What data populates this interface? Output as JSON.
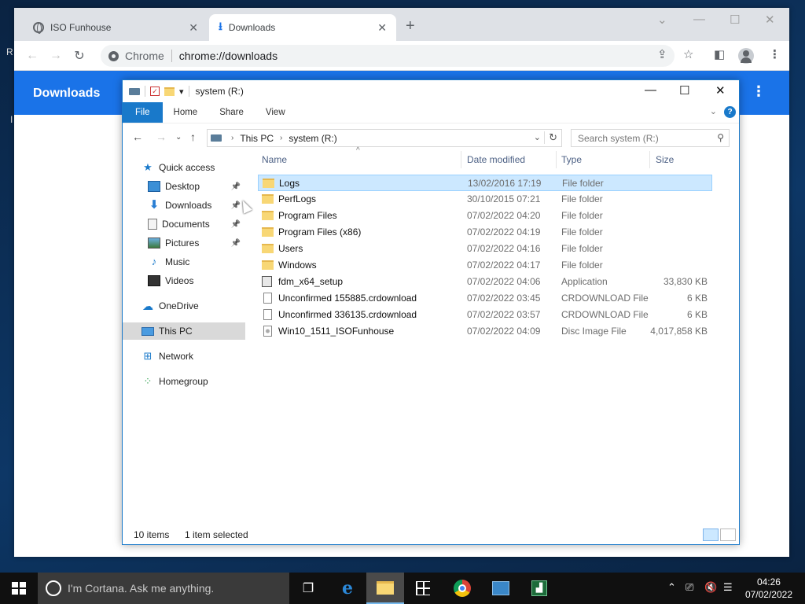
{
  "desktop": {
    "edge_letters": [
      "R",
      "I"
    ]
  },
  "chrome": {
    "tabs": [
      {
        "title": "ISO Funhouse",
        "active": false
      },
      {
        "title": "Downloads",
        "active": true
      }
    ],
    "omnibox": {
      "label": "Chrome",
      "url": "chrome://downloads"
    },
    "page": {
      "title": "Downloads"
    }
  },
  "explorer": {
    "title": "system (R:)",
    "ribbon_tabs": [
      "File",
      "Home",
      "Share",
      "View"
    ],
    "breadcrumb": [
      "This PC",
      "system (R:)"
    ],
    "search_placeholder": "Search system (R:)",
    "columns": {
      "name": "Name",
      "date": "Date modified",
      "type": "Type",
      "size": "Size"
    },
    "nav": [
      {
        "label": "Quick access",
        "icon": "star-icon",
        "pinned": false
      },
      {
        "label": "Desktop",
        "icon": "desktop-icon",
        "pinned": true
      },
      {
        "label": "Downloads",
        "icon": "download-arrow-icon",
        "pinned": true
      },
      {
        "label": "Documents",
        "icon": "documents-icon",
        "pinned": true
      },
      {
        "label": "Pictures",
        "icon": "pictures-icon",
        "pinned": true
      },
      {
        "label": "Music",
        "icon": "music-icon",
        "pinned": false
      },
      {
        "label": "Videos",
        "icon": "videos-icon",
        "pinned": false
      },
      {
        "label": "OneDrive",
        "icon": "cloud-icon",
        "pinned": false
      },
      {
        "label": "This PC",
        "icon": "computer-icon",
        "pinned": false,
        "selected": true
      },
      {
        "label": "Network",
        "icon": "network-icon",
        "pinned": false
      },
      {
        "label": "Homegroup",
        "icon": "homegroup-icon",
        "pinned": false
      }
    ],
    "files": [
      {
        "name": "Logs",
        "date": "13/02/2016 17:19",
        "type": "File folder",
        "size": "",
        "icon": "folder",
        "selected": true
      },
      {
        "name": "PerfLogs",
        "date": "30/10/2015 07:21",
        "type": "File folder",
        "size": "",
        "icon": "folder"
      },
      {
        "name": "Program Files",
        "date": "07/02/2022 04:20",
        "type": "File folder",
        "size": "",
        "icon": "folder"
      },
      {
        "name": "Program Files (x86)",
        "date": "07/02/2022 04:19",
        "type": "File folder",
        "size": "",
        "icon": "folder"
      },
      {
        "name": "Users",
        "date": "07/02/2022 04:16",
        "type": "File folder",
        "size": "",
        "icon": "folder"
      },
      {
        "name": "Windows",
        "date": "07/02/2022 04:17",
        "type": "File folder",
        "size": "",
        "icon": "folder"
      },
      {
        "name": "fdm_x64_setup",
        "date": "07/02/2022 04:06",
        "type": "Application",
        "size": "33,830 KB",
        "icon": "app"
      },
      {
        "name": "Unconfirmed 155885.crdownload",
        "date": "07/02/2022 03:45",
        "type": "CRDOWNLOAD File",
        "size": "6 KB",
        "icon": "file"
      },
      {
        "name": "Unconfirmed 336135.crdownload",
        "date": "07/02/2022 03:57",
        "type": "CRDOWNLOAD File",
        "size": "6 KB",
        "icon": "file"
      },
      {
        "name": "Win10_1511_ISOFunhouse",
        "date": "07/02/2022 04:09",
        "type": "Disc Image File",
        "size": "4,017,858 KB",
        "icon": "disc"
      }
    ],
    "status": {
      "items": "10 items",
      "selected": "1 item selected"
    }
  },
  "taskbar": {
    "cortana_placeholder": "I'm Cortana. Ask me anything.",
    "clock_time": "04:26",
    "clock_date": "07/02/2022"
  }
}
